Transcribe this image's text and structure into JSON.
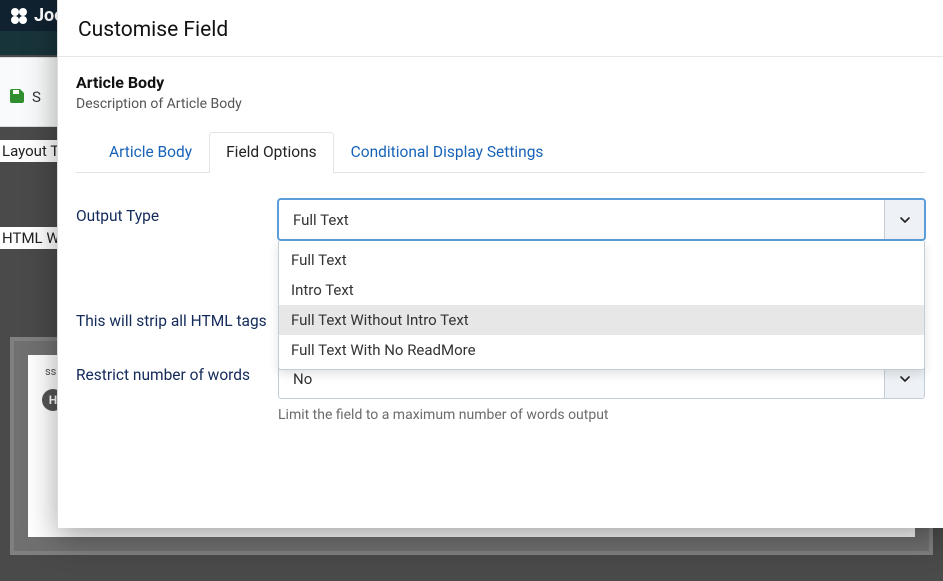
{
  "bg": {
    "brand": "Joomla!",
    "save_label": "S",
    "side1": "Layout T",
    "side2": "HTML W",
    "ss": "ss",
    "h": "H"
  },
  "modal": {
    "title": "Customise Field",
    "field_name": "Article Body",
    "field_desc": "Description of Article Body",
    "tabs": {
      "t0": "Article Body",
      "t1": "Field Options",
      "t2": "Conditional Display Settings"
    },
    "output_type": {
      "label": "Output Type",
      "selected": "Full Text",
      "options": {
        "o0": "Full Text",
        "o1": "Intro Text",
        "o2": "Full Text Without Intro Text",
        "o3": "Full Text With No ReadMore"
      }
    },
    "strip_note": "This will strip all HTML tags",
    "restrict": {
      "label": "Restrict number of words",
      "selected": "No",
      "help": "Limit the field to a maximum number of words output"
    }
  }
}
